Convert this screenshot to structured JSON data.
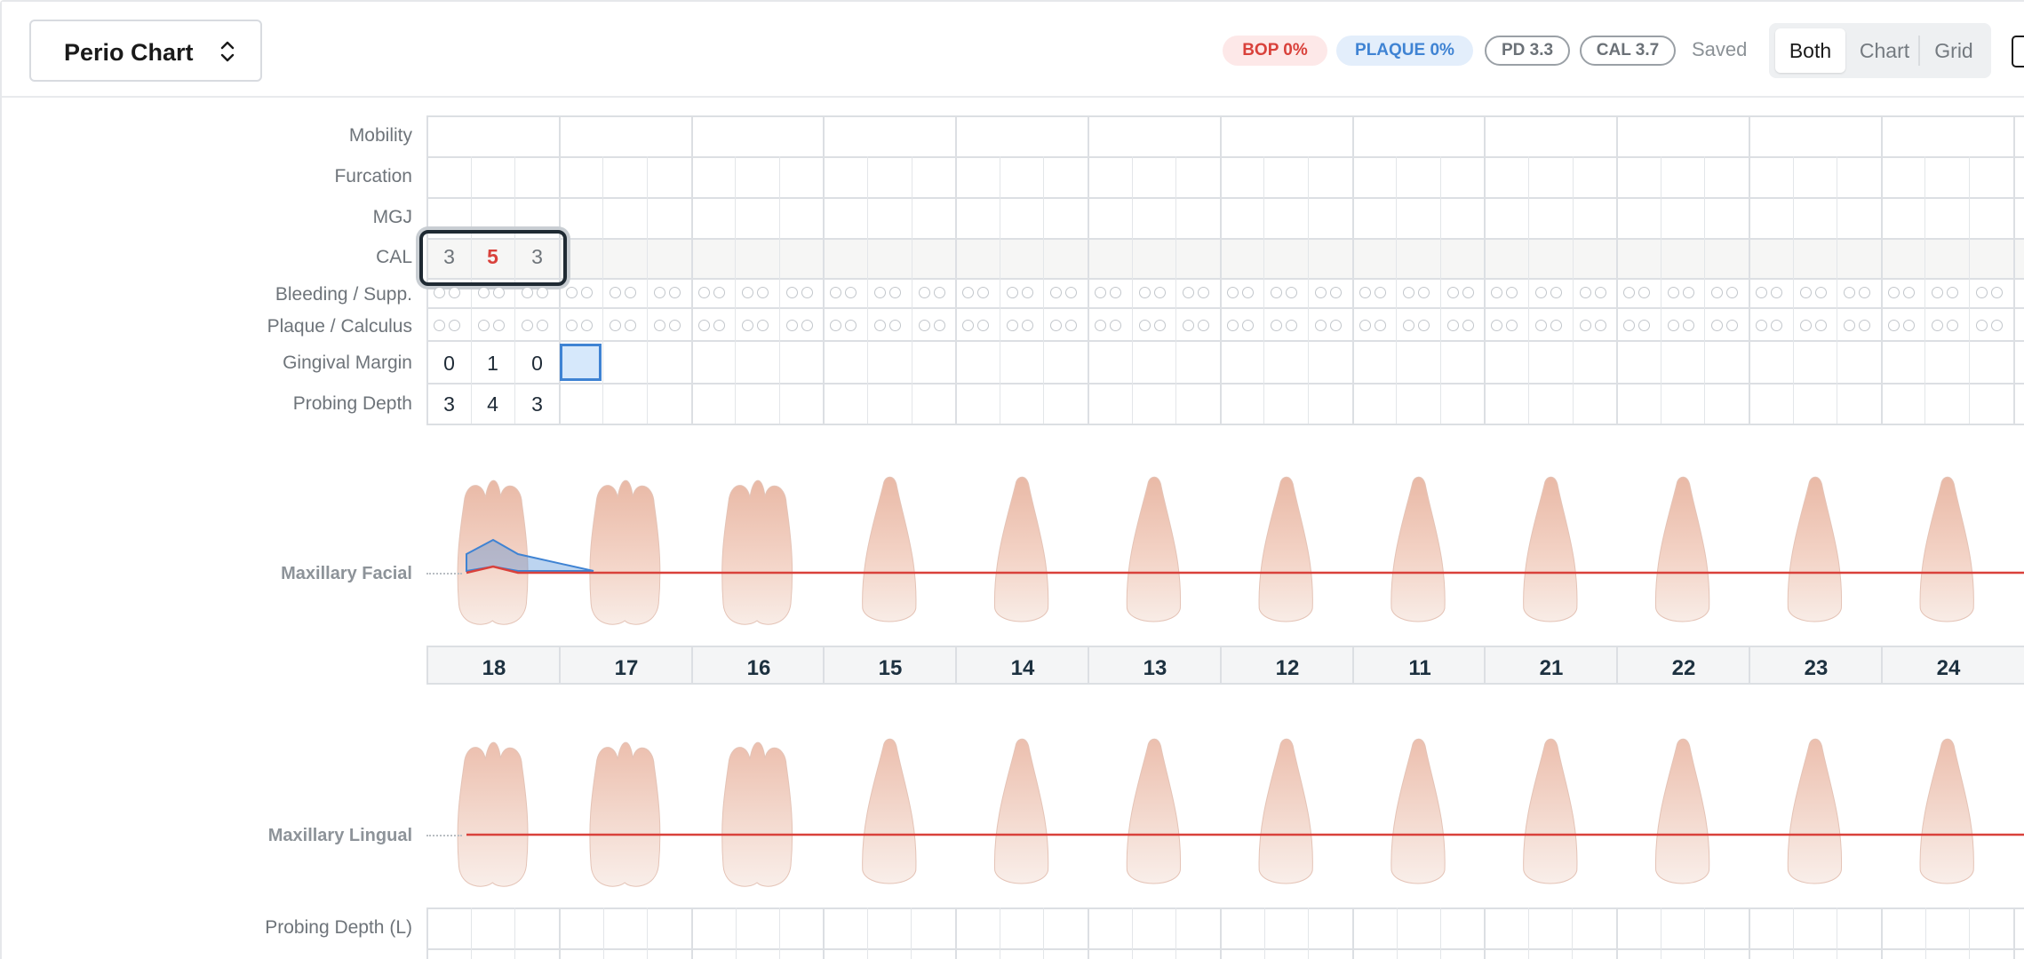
{
  "header": {
    "chart_selector": "Perio Chart",
    "badges": {
      "bop": "BOP 0%",
      "plaque": "PLAQUE 0%",
      "pd": "PD 3.3",
      "cal": "CAL 3.7"
    },
    "save_status": "Saved",
    "view_modes": [
      "Both",
      "Chart",
      "Grid"
    ],
    "active_view": "Both"
  },
  "rows": {
    "mobility": "Mobility",
    "furcation": "Furcation",
    "mgj": "MGJ",
    "cal": "CAL",
    "bleeding": "Bleeding / Supp.",
    "plaque": "Plaque / Calculus",
    "gingival_margin": "Gingival Margin",
    "probing_depth": "Probing Depth",
    "probing_depth_l": "Probing Depth (L)"
  },
  "values": {
    "cal": [
      "3",
      "5",
      "3"
    ],
    "gingival_margin": [
      "0",
      "1",
      "0"
    ],
    "probing_depth": [
      "3",
      "4",
      "3"
    ]
  },
  "views": {
    "facial": "Maxillary Facial",
    "lingual": "Maxillary Lingual"
  },
  "teeth": [
    "18",
    "17",
    "16",
    "15",
    "14",
    "13",
    "12",
    "11",
    "21",
    "22",
    "23",
    "24"
  ],
  "colors": {
    "gum_line": "#d9413b",
    "pocket_fill": "#3f83d3",
    "accent_blue": "#3f83d3",
    "alert_red": "#d9413b"
  }
}
